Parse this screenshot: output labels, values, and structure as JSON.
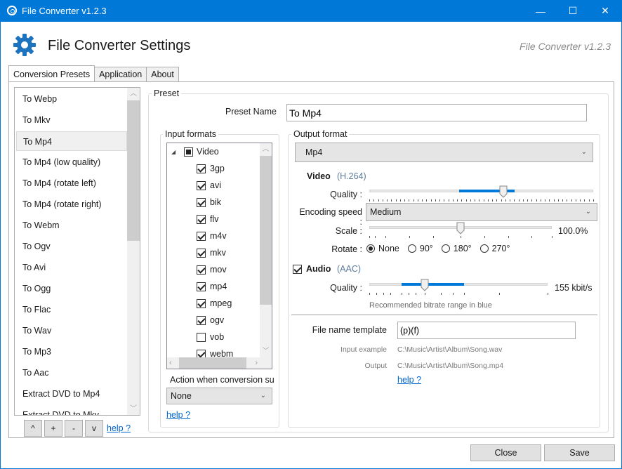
{
  "window": {
    "title": "File Converter v1.2.3",
    "controls": {
      "minimize": "—",
      "maximize": "☐",
      "close": "✕"
    },
    "accent_color": "#0078d7"
  },
  "header": {
    "title": "File Converter Settings",
    "version": "File Converter v1.2.3",
    "icon": "gear-icon"
  },
  "tabs": [
    {
      "label": "Conversion Presets",
      "active": true
    },
    {
      "label": "Application",
      "active": false
    },
    {
      "label": "About",
      "active": false
    }
  ],
  "presets": {
    "items": [
      "To Webp",
      "To Mkv",
      "To Mp4",
      "To Mp4 (low quality)",
      "To Mp4 (rotate left)",
      "To Mp4 (rotate right)",
      "To Webm",
      "To Ogv",
      "To Avi",
      "To Ogg",
      "To Flac",
      "To Wav",
      "To Mp3",
      "To Aac",
      "Extract DVD to Mp4",
      "Extract DVD to Mkv"
    ],
    "selected": "To Mp4",
    "buttons": {
      "up": "^",
      "add": "+",
      "remove": "-",
      "down": "v"
    },
    "help": "help ?"
  },
  "preset": {
    "group_label": "Preset",
    "name_label": "Preset Name",
    "name_value": "To Mp4"
  },
  "input_formats": {
    "group_label": "Input formats",
    "category": "Video",
    "formats": [
      {
        "name": "3gp",
        "checked": true
      },
      {
        "name": "avi",
        "checked": true
      },
      {
        "name": "bik",
        "checked": true
      },
      {
        "name": "flv",
        "checked": true
      },
      {
        "name": "m4v",
        "checked": true
      },
      {
        "name": "mkv",
        "checked": true
      },
      {
        "name": "mov",
        "checked": true
      },
      {
        "name": "mp4",
        "checked": true
      },
      {
        "name": "mpeg",
        "checked": true
      },
      {
        "name": "ogv",
        "checked": true
      },
      {
        "name": "vob",
        "checked": false
      },
      {
        "name": "webm",
        "checked": true
      }
    ],
    "action_label": "Action when conversion su",
    "action_value": "None",
    "help": "help ?"
  },
  "output_format": {
    "group_label": "Output format",
    "format": "Mp4",
    "video": {
      "label": "Video",
      "codec": "(H.264)",
      "quality_label": "Quality :",
      "quality_fraction": 0.6,
      "recommended_range": [
        0.4,
        0.65
      ],
      "encoding_speed_label": "Encoding speed :",
      "encoding_speed": "Medium",
      "scale_label": "Scale :",
      "scale_value": "100.0%",
      "scale_fraction": 0.5,
      "rotate_label": "Rotate :",
      "rotate_options": [
        "None",
        "90°",
        "180°",
        "270°"
      ],
      "rotate_selected": "None"
    },
    "audio": {
      "enabled": true,
      "label": "Audio",
      "codec": "(AAC)",
      "quality_label": "Quality :",
      "quality_value": "155 kbit/s",
      "quality_fraction": 0.31,
      "recommended_range": [
        0.18,
        0.53
      ],
      "hint": "Recommended bitrate range in blue"
    },
    "file_name_template_label": "File name template",
    "file_name_template": "(p)(f)",
    "input_example_label": "Input example",
    "input_example": "C:\\Music\\Artist\\Album\\Song.wav",
    "output_label": "Output",
    "output_example": "C:\\Music\\Artist\\Album\\Song.mp4",
    "help": "help ?"
  },
  "footer": {
    "close": "Close",
    "save": "Save"
  }
}
